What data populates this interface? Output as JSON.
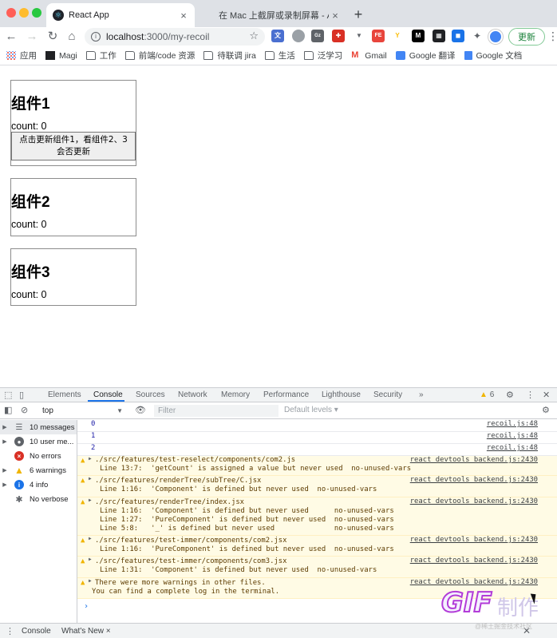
{
  "browser": {
    "tabs": [
      {
        "title": "React App",
        "favicon": "react-icon",
        "active": true
      },
      {
        "title": "在 Mac 上截屏或录制屏幕 - Appl",
        "favicon": "apple-icon",
        "active": false
      }
    ],
    "url_host": "localhost",
    "url_path": ":3000/my-recoil",
    "update_label": "更新",
    "bookmarks": [
      "应用",
      "Magi",
      "工作",
      "前端/code 资源",
      "待联调 jira",
      "生活",
      "泛学习",
      "Gmail",
      "Google 翻译",
      "Google 文档"
    ]
  },
  "page": {
    "components": [
      {
        "title": "组件1",
        "count_label": "count: 0",
        "button_label": "点击更新组件1，看组件2、3会否更新"
      },
      {
        "title": "组件2",
        "count_label": "count: 0"
      },
      {
        "title": "组件3",
        "count_label": "count: 0"
      }
    ]
  },
  "devtools": {
    "tabs": [
      "Elements",
      "Console",
      "Sources",
      "Network",
      "Memory",
      "Performance",
      "Lighthouse",
      "Security",
      "»"
    ],
    "active_tab": "Console",
    "warning_badge": "6",
    "context": "top",
    "filter_placeholder": "Filter",
    "levels_label": "Default levels ▾",
    "sidebar": [
      {
        "label": "10 messages",
        "icon": "list-icon",
        "color": "#5f6368"
      },
      {
        "label": "10 user me...",
        "icon": "user-icon",
        "color": "#5f6368"
      },
      {
        "label": "No errors",
        "icon": "error-icon",
        "color": "#d93025"
      },
      {
        "label": "6 warnings",
        "icon": "warning-icon",
        "color": "#f0b400"
      },
      {
        "label": "4 info",
        "icon": "info-icon",
        "color": "#1a73e8"
      },
      {
        "label": "No verbose",
        "icon": "bug-icon",
        "color": "#5f6368"
      }
    ],
    "logs": [
      {
        "value": "0",
        "source": "recoil.js:48"
      },
      {
        "value": "1",
        "source": "recoil.js:48"
      },
      {
        "value": "2",
        "source": "recoil.js:48"
      }
    ],
    "warnings": [
      {
        "file": "./src/features/test-reselect/components/com2.js",
        "source": "react_devtools_backend.js:2430",
        "lines": [
          "Line 13:7:  'getCount' is assigned a value but never used  no-unused-vars"
        ]
      },
      {
        "file": "./src/features/renderTree/subTree/C.jsx",
        "source": "react_devtools_backend.js:2430",
        "lines": [
          "Line 1:16:  'Component' is defined but never used  no-unused-vars"
        ]
      },
      {
        "file": "./src/features/renderTree/index.jsx",
        "source": "react_devtools_backend.js:2430",
        "lines": [
          "Line 1:16:  'Component' is defined but never used      no-unused-vars",
          "Line 1:27:  'PureComponent' is defined but never used  no-unused-vars",
          "Line 5:8:   '_' is defined but never used              no-unused-vars"
        ]
      },
      {
        "file": "./src/features/test-immer/components/com2.jsx",
        "source": "react_devtools_backend.js:2430",
        "lines": [
          "Line 1:16:  'PureComponent' is defined but never used  no-unused-vars"
        ]
      },
      {
        "file": "./src/features/test-immer/components/com3.jsx",
        "source": "react_devtools_backend.js:2430",
        "lines": [
          "Line 1:31:  'Component' is defined but never used  no-unused-vars"
        ]
      },
      {
        "file": "There were more warnings in other files.",
        "source": "react_devtools_backend.js:2430",
        "lines": [
          "You can find a complete log in the terminal."
        ]
      }
    ],
    "prompt": "›",
    "drawer_tabs": [
      "Console",
      "What's New ×"
    ]
  },
  "watermark": {
    "brand": "GIF",
    "cn": "制作",
    "site": "@稀土掘金技术社区"
  }
}
